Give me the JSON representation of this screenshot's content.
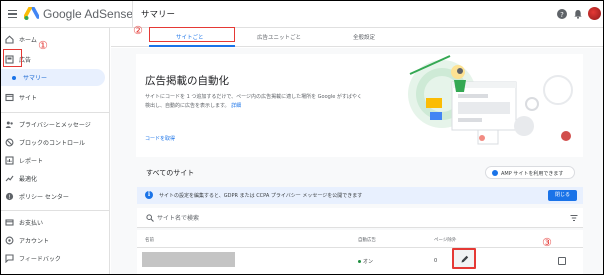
{
  "header": {
    "brand": "Google AdSense",
    "page_title": "サマリー"
  },
  "sidebar": {
    "items": [
      {
        "label": "ホーム",
        "icon": "home-icon"
      },
      {
        "label": "広告",
        "icon": "ads-icon"
      },
      {
        "label": "サマリー",
        "icon": "dot"
      },
      {
        "label": "サイト",
        "icon": "sites-icon"
      },
      {
        "label": "プライバシーとメッセージ",
        "icon": "privacy-icon"
      },
      {
        "label": "ブロックのコントロール",
        "icon": "block-icon"
      },
      {
        "label": "レポート",
        "icon": "reports-icon"
      },
      {
        "label": "最適化",
        "icon": "optimize-icon"
      },
      {
        "label": "ポリシー センター",
        "icon": "policy-icon"
      },
      {
        "label": "お支払い",
        "icon": "payments-icon"
      },
      {
        "label": "アカウント",
        "icon": "account-icon"
      },
      {
        "label": "フィードバック",
        "icon": "feedback-icon"
      }
    ]
  },
  "tabs": [
    {
      "label": "サイトごと",
      "active": true
    },
    {
      "label": "広告ユニットごと",
      "active": false
    },
    {
      "label": "全般設定",
      "active": false
    }
  ],
  "card": {
    "title": "広告掲載の自動化",
    "description": "サイトにコードを 1 つ追加するだけで、ページ内の広告掲載に適した場所を Google がすばやく検出し、自動的に広告を表示します。",
    "learn_more": "詳細",
    "get_code_link": "コードを取得"
  },
  "sites": {
    "title": "すべてのサイト",
    "amp_button": "AMP サイトを利用できます",
    "banner_text": "サイトの設定を編集すると、GDPR または CCPA プライバシー メッセージを公開できます",
    "banner_button": "閉じる",
    "search_placeholder": "サイト名で検索",
    "columns": [
      "名前",
      "自動広告",
      "ページ除外"
    ],
    "rows": [
      {
        "auto_ads": "オン",
        "excluded_pages": "0"
      }
    ]
  },
  "annotations": [
    "①",
    "②",
    "③"
  ],
  "colors": {
    "accent": "#1a73e8",
    "annotation": "#e53935",
    "selected_bg": "#e8f0fe"
  }
}
